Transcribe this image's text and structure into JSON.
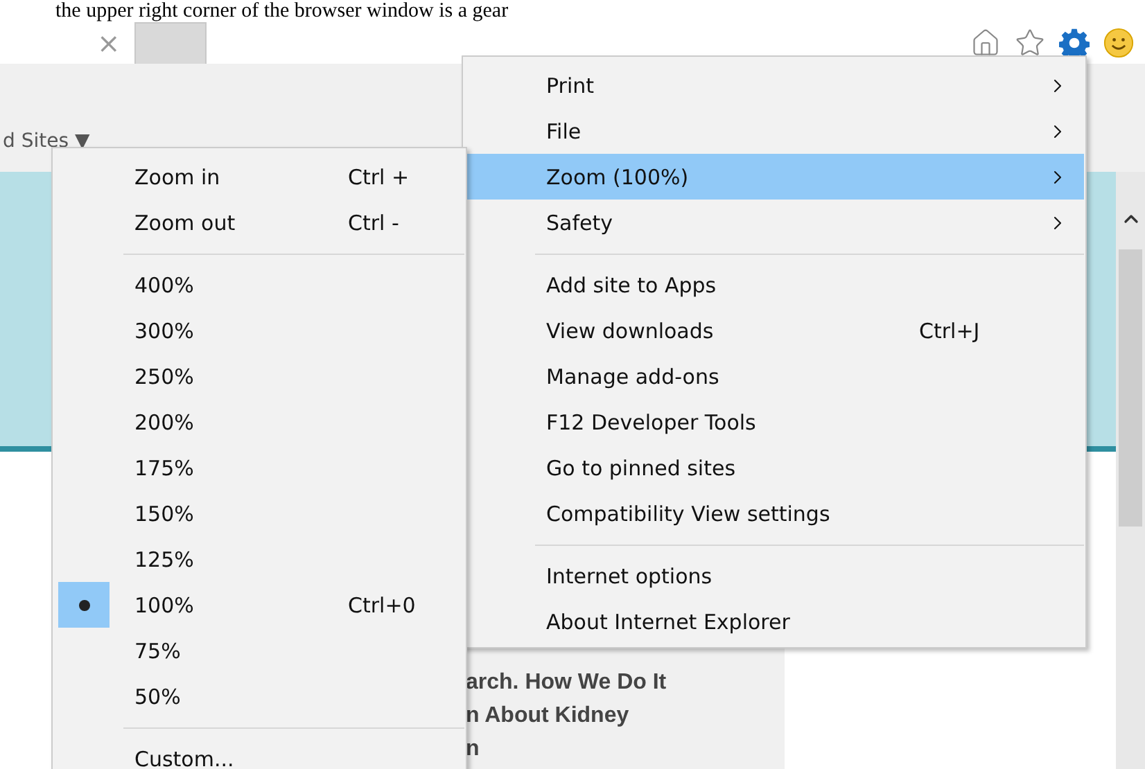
{
  "document_line": "the upper right corner of the browser window is a gear",
  "tab": {
    "close": "×"
  },
  "favorites_bar": {
    "label": "d Sites",
    "arrow": "▼"
  },
  "page_text": [
    "arch. How We Do It",
    "n About Kidney",
    "n"
  ],
  "menu": [
    {
      "kind": "item",
      "label": "Print",
      "has_submenu": true,
      "selected": false
    },
    {
      "kind": "item",
      "label": "File",
      "has_submenu": true,
      "selected": false
    },
    {
      "kind": "item",
      "label": "Zoom (100%)",
      "has_submenu": true,
      "selected": true
    },
    {
      "kind": "item",
      "label": "Safety",
      "has_submenu": true,
      "selected": false
    },
    {
      "kind": "separator"
    },
    {
      "kind": "item",
      "label": "Add site to Apps",
      "has_submenu": false,
      "selected": false
    },
    {
      "kind": "item",
      "label": "View downloads",
      "shortcut": "Ctrl+J",
      "has_submenu": false,
      "selected": false
    },
    {
      "kind": "item",
      "label": "Manage add-ons",
      "has_submenu": false,
      "selected": false
    },
    {
      "kind": "item",
      "label": "F12 Developer Tools",
      "has_submenu": false,
      "selected": false
    },
    {
      "kind": "item",
      "label": "Go to pinned sites",
      "has_submenu": false,
      "selected": false
    },
    {
      "kind": "item",
      "label": "Compatibility View settings",
      "has_submenu": false,
      "selected": false
    },
    {
      "kind": "separator"
    },
    {
      "kind": "item",
      "label": "Internet options",
      "has_submenu": false,
      "selected": false
    },
    {
      "kind": "item",
      "label": "About Internet Explorer",
      "has_submenu": false,
      "selected": false
    }
  ],
  "zoom_submenu": [
    {
      "kind": "item",
      "label": "Zoom in",
      "shortcut": "Ctrl +",
      "checked": false
    },
    {
      "kind": "item",
      "label": "Zoom out",
      "shortcut": "Ctrl -",
      "checked": false
    },
    {
      "kind": "separator"
    },
    {
      "kind": "item",
      "label": "400%",
      "checked": false
    },
    {
      "kind": "item",
      "label": "300%",
      "checked": false
    },
    {
      "kind": "item",
      "label": "250%",
      "checked": false
    },
    {
      "kind": "item",
      "label": "200%",
      "checked": false
    },
    {
      "kind": "item",
      "label": "175%",
      "checked": false
    },
    {
      "kind": "item",
      "label": "150%",
      "checked": false
    },
    {
      "kind": "item",
      "label": "125%",
      "checked": false
    },
    {
      "kind": "item",
      "label": "100%",
      "shortcut": "Ctrl+0",
      "checked": true
    },
    {
      "kind": "item",
      "label": "75%",
      "checked": false
    },
    {
      "kind": "item",
      "label": "50%",
      "checked": false
    },
    {
      "kind": "separator"
    },
    {
      "kind": "item",
      "label": "Custom...",
      "checked": false
    }
  ]
}
